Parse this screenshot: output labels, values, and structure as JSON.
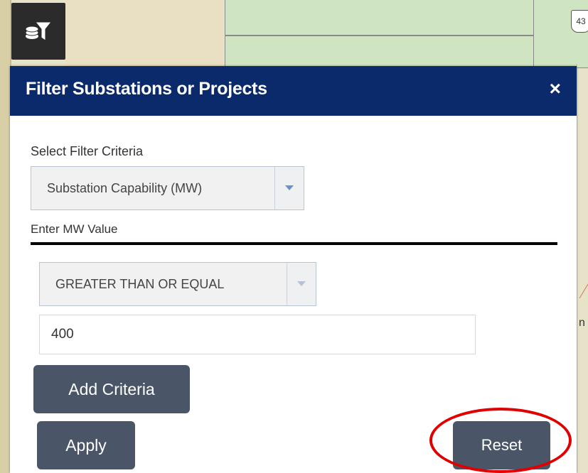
{
  "map": {
    "road_label": "43",
    "edge_label": "n"
  },
  "toolbar": {
    "filter_icon": "layers-filter-icon"
  },
  "panel": {
    "title": "Filter Substations or Projects",
    "close_label": "×",
    "select_criteria_label": "Select Filter Criteria",
    "criteria_select_value": "Substation Capability (MW)",
    "enter_value_label": "Enter MW Value",
    "operator_select_value": "GREATER THAN OR EQUAL",
    "value_input": "400",
    "add_criteria_label": "Add Criteria",
    "apply_label": "Apply",
    "reset_label": "Reset"
  },
  "colors": {
    "header": "#0b2a6b",
    "button": "#4a5568",
    "highlight": "#e00000"
  }
}
